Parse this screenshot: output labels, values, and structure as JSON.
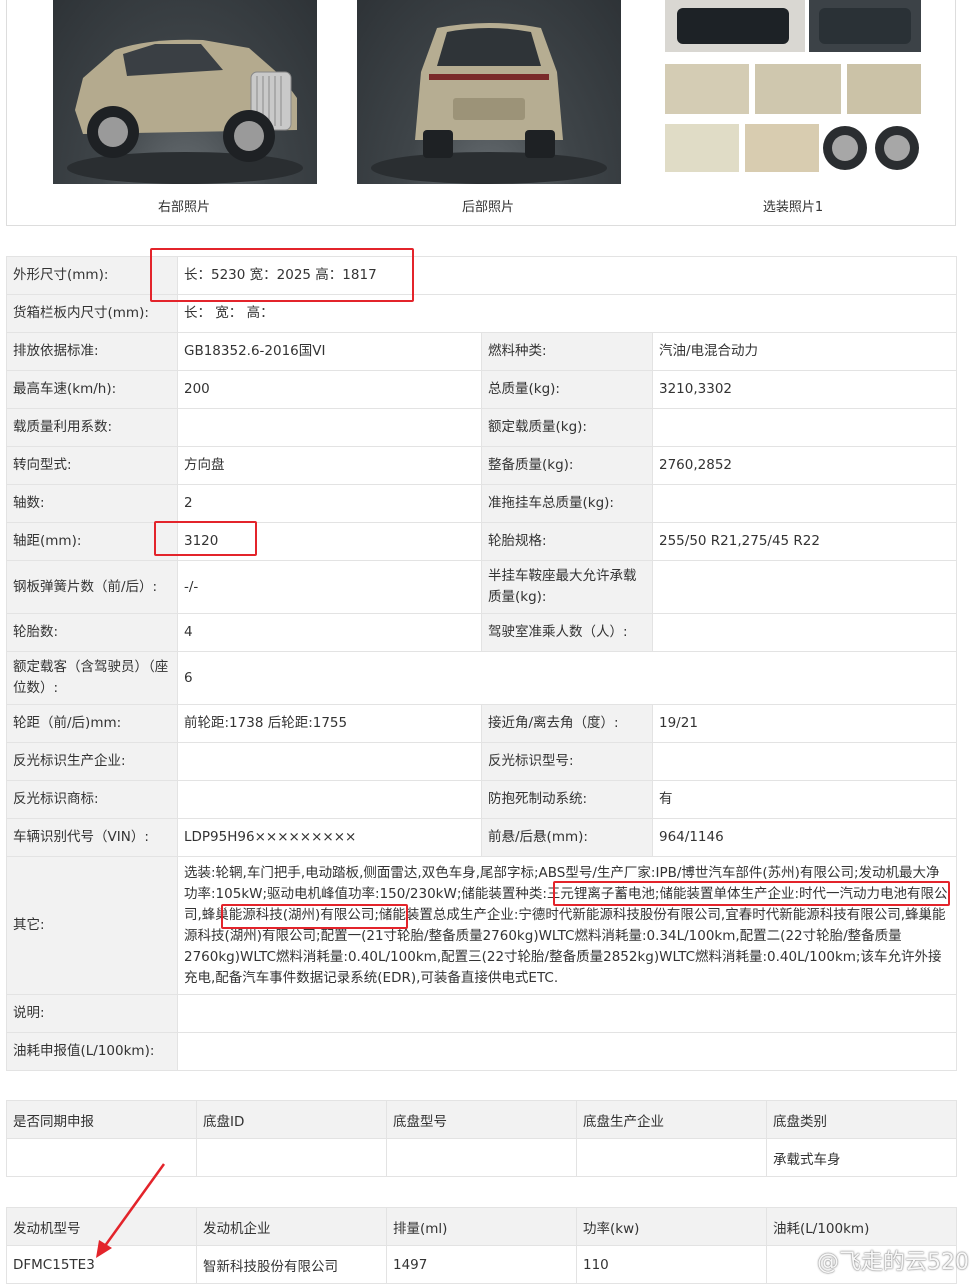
{
  "photos": [
    {
      "caption": "右部照片"
    },
    {
      "caption": "后部照片"
    },
    {
      "caption": "选装照片1"
    }
  ],
  "spec": {
    "dimensions": {
      "label": "外形尺寸(mm):",
      "value": "长：5230 宽：2025 高：1817"
    },
    "cargo": {
      "label": "货箱栏板内尺寸(mm):",
      "value": "长：  宽：  高："
    },
    "rows": [
      {
        "l1": "排放依据标准:",
        "v1": "GB18352.6-2016国VI",
        "l2": "燃料种类:",
        "v2": "汽油/电混合动力"
      },
      {
        "l1": "最高车速(km/h):",
        "v1": "200",
        "l2": "总质量(kg):",
        "v2": "3210,3302"
      },
      {
        "l1": "载质量利用系数:",
        "v1": "",
        "l2": "额定载质量(kg):",
        "v2": ""
      },
      {
        "l1": "转向型式:",
        "v1": "方向盘",
        "l2": "整备质量(kg):",
        "v2": "2760,2852"
      },
      {
        "l1": "轴数:",
        "v1": "2",
        "l2": "准拖挂车总质量(kg):",
        "v2": ""
      },
      {
        "l1": "轴距(mm):",
        "v1": "3120",
        "l2": "轮胎规格:",
        "v2": "255/50 R21,275/45 R22"
      },
      {
        "l1": "钢板弹簧片数（前/后）:",
        "v1": "-/-",
        "l2": "半挂车鞍座最大允许承载质量(kg):",
        "v2": ""
      },
      {
        "l1": "轮胎数:",
        "v1": "4",
        "l2": "驾驶室准乘人数（人）:",
        "v2": ""
      }
    ],
    "seats": {
      "label": "额定载客（含驾驶员）（座位数）:",
      "value": "6"
    },
    "rows2": [
      {
        "l1": "轮距（前/后)mm:",
        "v1": "前轮距:1738 后轮距:1755",
        "l2": "接近角/离去角（度）:",
        "v2": "19/21"
      },
      {
        "l1": "反光标识生产企业:",
        "v1": "",
        "l2": "反光标识型号:",
        "v2": ""
      },
      {
        "l1": "反光标识商标:",
        "v1": "",
        "l2": "防抱死制动系统:",
        "v2": "有"
      },
      {
        "l1": "车辆识别代号（VIN）:",
        "v1": "LDP95H96×××××××××",
        "l2": "前悬/后悬(mm):",
        "v2": "964/1146"
      }
    ],
    "other": {
      "label": "其它:",
      "value": "选装:轮辋,车门把手,电动踏板,侧面雷达,双色车身,尾部字标;ABS型号/生产厂家:IPB/博世汽车部件(苏州)有限公司;发动机最大净功率:105kW;驱动电机峰值功率:150/230kW;储能装置种类:三元锂离子蓄电池;储能装置单体生产企业:时代一汽动力电池有限公司,蜂巢能源科技(湖州)有限公司;储能装置总成生产企业:宁德时代新能源科技股份有限公司,宜春时代新能源科技有限公司,蜂巢能源科技(湖州)有限公司;配置一(21寸轮胎/整备质量2760kg)WLTC燃料消耗量:0.34L/100km,配置二(22寸轮胎/整备质量2760kg)WLTC燃料消耗量:0.40L/100km,配置三(22寸轮胎/整备质量2852kg)WLTC燃料消耗量:0.40L/100km;该车允许外接充电,配备汽车事件数据记录系统(EDR),可装备直接供电式ETC."
    },
    "note": {
      "label": "说明:",
      "value": ""
    },
    "fuel": {
      "label": "油耗申报值(L/100km):",
      "value": ""
    }
  },
  "chassis": {
    "headers": [
      "是否同期申报",
      "底盘ID",
      "底盘型号",
      "底盘生产企业",
      "底盘类别"
    ],
    "row": [
      "",
      "",
      "",
      "",
      "承载式车身"
    ]
  },
  "engine": {
    "headers": [
      "发动机型号",
      "发动机企业",
      "排量(ml)",
      "功率(kw)",
      "油耗(L/100km)"
    ],
    "row": [
      "DFMC15TE3",
      "智新科技股份有限公司",
      "1497",
      "110",
      ""
    ]
  },
  "watermark": "@飞走的云520",
  "colors": {
    "highlight": "#e3242b",
    "label_bg": "#f2f2f2",
    "border": "#e3e3e3"
  }
}
